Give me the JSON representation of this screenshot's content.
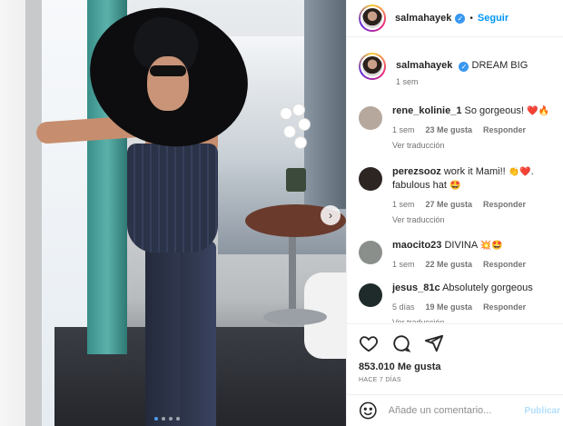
{
  "post": {
    "image_alt": "Post photo",
    "next_icon": "chevron-right-icon",
    "carousel": {
      "count": 4,
      "active": 0
    }
  },
  "header": {
    "username": "salmahayek",
    "separator": "•",
    "follow_label": "Seguir"
  },
  "caption": {
    "username": "salmahayek",
    "text": "DREAM BIG",
    "time": "1 sem"
  },
  "comments": [
    {
      "username": "rene_kolinie_1",
      "text": "So gorgeous!",
      "emoji": "❤️🔥",
      "time": "1 sem",
      "likes": "23 Me gusta",
      "reply": "Responder",
      "translation": "Ver traducción",
      "avatar_color": "#b7a89d"
    },
    {
      "username": "perezsooz",
      "text": "work it Mami!!",
      "emoji": "👏❤️.",
      "text2": "fabulous hat",
      "emoji2": "🤩",
      "time": "1 sem",
      "likes": "27 Me gusta",
      "reply": "Responder",
      "translation": "Ver traducción",
      "avatar_color": "#2d2522"
    },
    {
      "username": "maocito23",
      "text": "DIVINA",
      "emoji": "💥🤩",
      "time": "1 sem",
      "likes": "22 Me gusta",
      "reply": "Responder",
      "translation": "",
      "avatar_color": "#8a8f8c"
    },
    {
      "username": "jesus_81c",
      "text": "Absolutely gorgeous",
      "emoji": "",
      "time": "5 días",
      "likes": "19 Me gusta",
      "reply": "Responder",
      "translation": "Ver traducción",
      "avatar_color": "#1f2a2a"
    }
  ],
  "actions": {
    "like_icon": "heart-icon",
    "comment_icon": "comment-icon",
    "share_icon": "share-icon",
    "likes_count": "853.010 Me gusta",
    "posted_ago": "HACE 7 DÍAS"
  },
  "composer": {
    "emoji_icon": "smiley-icon",
    "placeholder": "Añade un comentario...",
    "publish_label": "Publicar"
  },
  "colors": {
    "accent": "#0095f6",
    "verified": "#3897f0",
    "meta": "#737373"
  }
}
